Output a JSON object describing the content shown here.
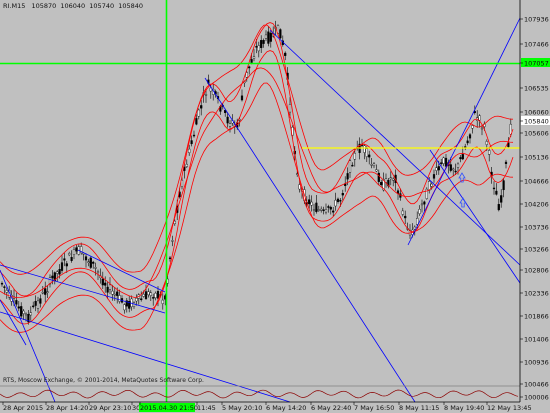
{
  "window": {
    "symbol_header": "RI.M15",
    "ohlc_values": [
      "105870",
      "106040",
      "105740",
      "105840"
    ],
    "copyright": "RTS, Moscow Exchange, © 2001-2014, MetaQuotes Software Corp."
  },
  "price_axis": {
    "labels": [
      "107936",
      "107466",
      "107057",
      "106535",
      "106060",
      "105840",
      "105606",
      "105136",
      "104666",
      "104206",
      "103736",
      "103266",
      "102806",
      "102336",
      "101866",
      "101406",
      "100936",
      "100466",
      "100006"
    ],
    "highlighted": [
      {
        "label": "107057",
        "background": "#00ff00"
      },
      {
        "label": "105840",
        "background": "#ffffff"
      }
    ]
  },
  "time_axis": {
    "labels": [
      "28 Apr 2015",
      "28 Apr 14:20",
      "29 Apr 23:10",
      "30 Apr 08:00",
      "2015.04.30 21:50",
      "11:45",
      "5 May 20:10",
      "6 May 14:20",
      "6 May 22:40",
      "7 May 16:50",
      "8 May 11:15",
      "8 May 19:40",
      "12 May 13:45"
    ],
    "highlighted": {
      "label": "2015.04.30 21:50",
      "background": "#00ff00"
    }
  },
  "colors": {
    "background": "#c0c0c0",
    "candles": "#000000",
    "bollinger_bands": "#ff0000",
    "channel_lines": "#0000ff",
    "crosshair": "#00ff00",
    "level_line": "#ffff00",
    "oscillator": "#8b0000"
  },
  "icons": [
    "up-arrow-icon",
    "up-arrow-icon"
  ]
}
